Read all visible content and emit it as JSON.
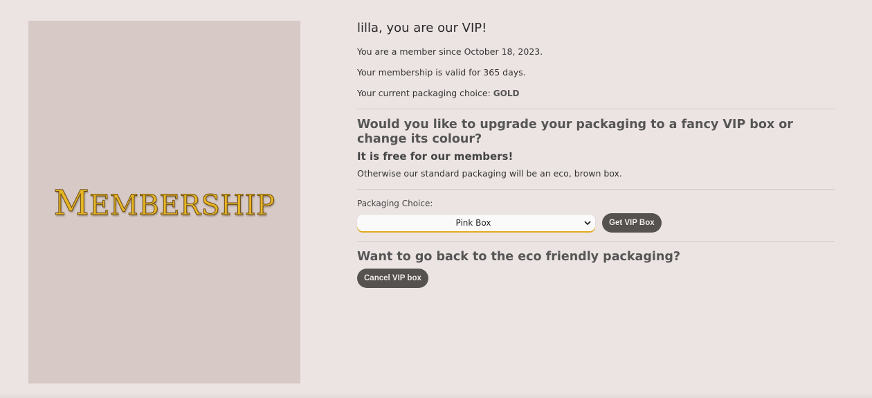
{
  "banner": {
    "first_letter": "M",
    "rest": "EMBERSHIP"
  },
  "greeting": "lilla, you are our VIP!",
  "member_since": "You are a member since October 18, 2023.",
  "validity": "Your membership is valid for 365 days.",
  "packaging": {
    "label": "Your current packaging choice:",
    "value": "GOLD"
  },
  "upgrade": {
    "heading": "Would you like to upgrade your packaging to a fancy VIP box or change its colour?",
    "free": "It is free for our members!",
    "note": "Otherwise our standard packaging will be an eco, brown box."
  },
  "form": {
    "label": "Packaging Choice:",
    "selected": "Pink Box",
    "submit": "Get VIP Box"
  },
  "cancel": {
    "heading": "Want to go back to the eco friendly packaging?",
    "button": "Cancel VIP box"
  },
  "colors": {
    "background": "#ece4e3",
    "banner": "#d6c9c6",
    "accent_gold": "#e8b525",
    "button": "#555250"
  }
}
